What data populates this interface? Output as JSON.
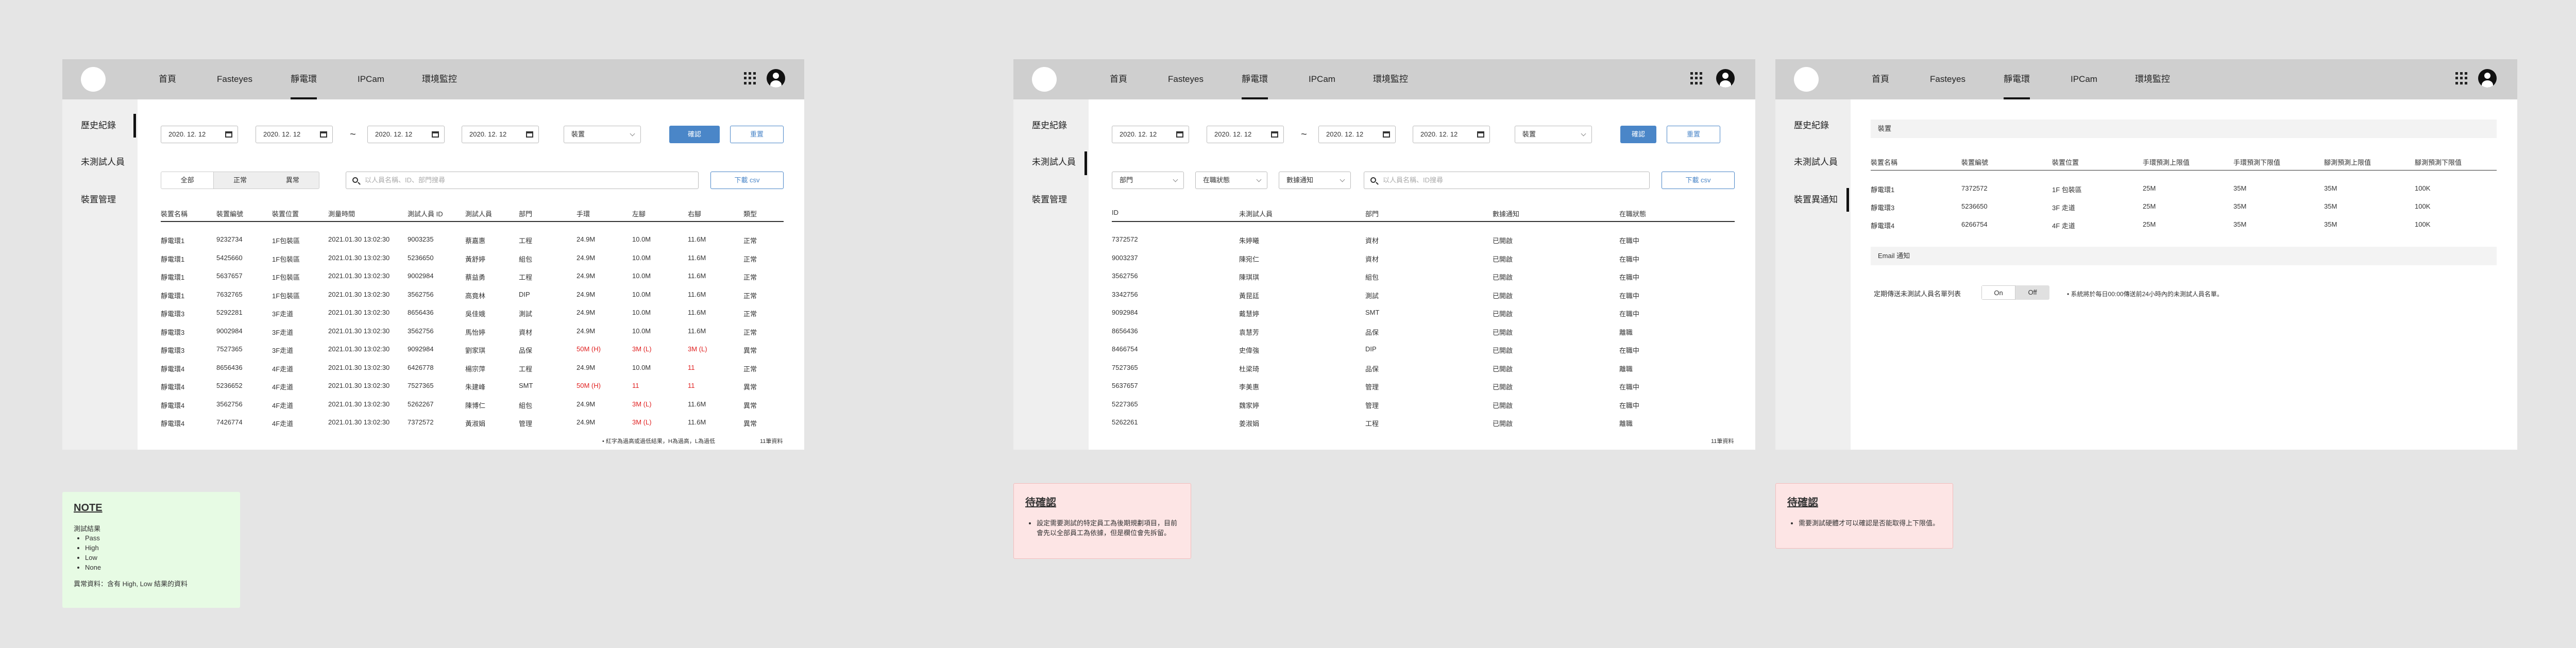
{
  "nav": {
    "home": "首頁",
    "fasteyes": "Fasteyes",
    "thermo": "靜電環",
    "ipcam": "IPCam",
    "env": "環境監控"
  },
  "side": {
    "history": "歷史紀錄",
    "untested": "未測試人員",
    "devices": "裝置管理",
    "notify": "裝置異通知"
  },
  "frame1": {
    "dates": [
      "2020. 12. 12",
      "2020. 12. 12",
      "2020. 12. 12",
      "2020. 12. 12"
    ],
    "tilde": "~",
    "device_select": "裝置",
    "confirm": "確認",
    "reset": "重置",
    "seg": [
      "全部",
      "正常",
      "異常"
    ],
    "search_placeholder": "以人員名稱、ID、部門搜尋",
    "download": "下載 csv",
    "headers": [
      "裝置名稱",
      "裝置編號",
      "裝置位置",
      "測量時間",
      "測試人員 ID",
      "測試人員",
      "部門",
      "手環",
      "左腳",
      "右腳",
      "類型"
    ],
    "rows": [
      [
        "靜電環1",
        "9232734",
        "1F包裝區",
        "2021.01.30 13:02:30",
        "9003235",
        "蔡嘉惠",
        "工程",
        "24.9M",
        "10.0M",
        "11.6M",
        "正常"
      ],
      [
        "靜電環1",
        "5425660",
        "1F包裝區",
        "2021.01.30 13:02:30",
        "5236650",
        "黃舒婷",
        "組包",
        "24.9M",
        "10.0M",
        "11.6M",
        "正常"
      ],
      [
        "靜電環1",
        "5637657",
        "1F包裝區",
        "2021.01.30 13:02:30",
        "9002984",
        "蔡益勇",
        "工程",
        "24.9M",
        "10.0M",
        "11.6M",
        "正常"
      ],
      [
        "靜電環1",
        "7632765",
        "1F包裝區",
        "2021.01.30 13:02:30",
        "3562756",
        "高竟林",
        "DIP",
        "24.9M",
        "10.0M",
        "11.6M",
        "正常"
      ],
      [
        "靜電環3",
        "5292281",
        "3F走道",
        "2021.01.30 13:02:30",
        "8656436",
        "吳佳娥",
        "測試",
        "24.9M",
        "10.0M",
        "11.6M",
        "正常"
      ],
      [
        "靜電環3",
        "9002984",
        "3F走道",
        "2021.01.30 13:02:30",
        "3562756",
        "馬怡婷",
        "資材",
        "24.9M",
        "10.0M",
        "11.6M",
        "正常"
      ],
      [
        "靜電環3",
        "7527365",
        "3F走道",
        "2021.01.30 13:02:30",
        "9092984",
        "劉家琪",
        "品保",
        "50M (H)",
        "3M (L)",
        "3M (L)",
        "異常"
      ],
      [
        "靜電環4",
        "8656436",
        "4F走道",
        "2021.01.30 13:02:30",
        "6426778",
        "楊宗萍",
        "工程",
        "24.9M",
        "10.0M",
        "11",
        "正常"
      ],
      [
        "靜電環4",
        "5236652",
        "4F走道",
        "2021.01.30 13:02:30",
        "7527365",
        "朱建峰",
        "SMT",
        "50M (H)",
        "11",
        "11",
        "異常"
      ],
      [
        "靜電環4",
        "3562756",
        "4F走道",
        "2021.01.30 13:02:30",
        "5262267",
        "陳博仁",
        "組包",
        "24.9M",
        "3M (L)",
        "11.6M",
        "異常"
      ],
      [
        "靜電環4",
        "7426774",
        "4F走道",
        "2021.01.30 13:02:30",
        "7372572",
        "黃淑娟",
        "管理",
        "24.9M",
        "3M (L)",
        "11.6M",
        "異常"
      ]
    ],
    "footnote": "• 紅字為過高或過低結果，H為過高，L為過低",
    "count": "11筆資料"
  },
  "frame2": {
    "dates": [
      "2020. 12. 12",
      "2020. 12. 12",
      "2020. 12. 12",
      "2020. 12. 12"
    ],
    "tilde": "~",
    "device_select": "裝置",
    "confirm": "確認",
    "reset": "重置",
    "filters": [
      "部門",
      "在職狀態",
      "數據通知"
    ],
    "search_placeholder": "以人員名稱、ID搜尋",
    "download": "下載 csv",
    "headers": [
      "ID",
      "未測試人員",
      "部門",
      "數據通知",
      "在職狀態"
    ],
    "rows": [
      [
        "7372572",
        "朱婷曦",
        "資材",
        "已開啟",
        "在職中"
      ],
      [
        "9003237",
        "陳宛仁",
        "資材",
        "已開啟",
        "在職中"
      ],
      [
        "3562756",
        "陳琪琪",
        "組包",
        "已開啟",
        "在職中"
      ],
      [
        "3342756",
        "黃昆廷",
        "測試",
        "已開啟",
        "在職中"
      ],
      [
        "9092984",
        "戴慧婷",
        "SMT",
        "已開啟",
        "在職中"
      ],
      [
        "8656436",
        "袁慧芳",
        "品保",
        "已開啟",
        "離職"
      ],
      [
        "8466754",
        "史偉強",
        "DIP",
        "已開啟",
        "在職中"
      ],
      [
        "7527365",
        "杜梁琦",
        "品保",
        "已開啟",
        "離職"
      ],
      [
        "5637657",
        "李美惠",
        "管理",
        "已開啟",
        "在職中"
      ],
      [
        "5227365",
        "魏家婷",
        "管理",
        "已開啟",
        "在職中"
      ],
      [
        "5262261",
        "姜淑娟",
        "工程",
        "已開啟",
        "離職"
      ]
    ],
    "count": "11筆資料"
  },
  "frame3": {
    "section1": "裝置",
    "headers": [
      "裝置名稱",
      "裝置編號",
      "裝置位置",
      "手環預測上限值",
      "手環預測下限值",
      "腳測預測上限值",
      "腳測預測下限值"
    ],
    "rows": [
      [
        "靜電環1",
        "7372572",
        "1F 包裝區",
        "25M",
        "35M",
        "35M",
        "100K"
      ],
      [
        "靜電環3",
        "5236650",
        "3F 走道",
        "25M",
        "35M",
        "35M",
        "100K"
      ],
      [
        "靜電環4",
        "6266754",
        "4F 走道",
        "25M",
        "35M",
        "35M",
        "100K"
      ]
    ],
    "section2": "Email 通知",
    "label": "定期傳送未測試人員名單列表",
    "on": "On",
    "off": "Off",
    "hint": "• 系統將於每日00:00傳送前24小時內的未測試人員名單。"
  },
  "notes": {
    "n1_title": "NOTE",
    "n1_sub": "測試結果",
    "n1_items": [
      "Pass",
      "High",
      "Low",
      "None"
    ],
    "n1_footer": "異常資料：含有 High, Low 結果的資料",
    "n2_title": "待確認",
    "n2_item": "設定需要測試的特定員工為後期規劃項目，目前會先以全部員工為依據，但是欄位會先拆留。",
    "n3_title": "待確認",
    "n3_item": "需要測試硬體才可以確認是否能取得上下限值。"
  },
  "colors": {
    "accent": "#4a86c8",
    "abnormal": "#e02020",
    "note_green": "#e7fbe4",
    "note_red": "#fde5e5"
  }
}
